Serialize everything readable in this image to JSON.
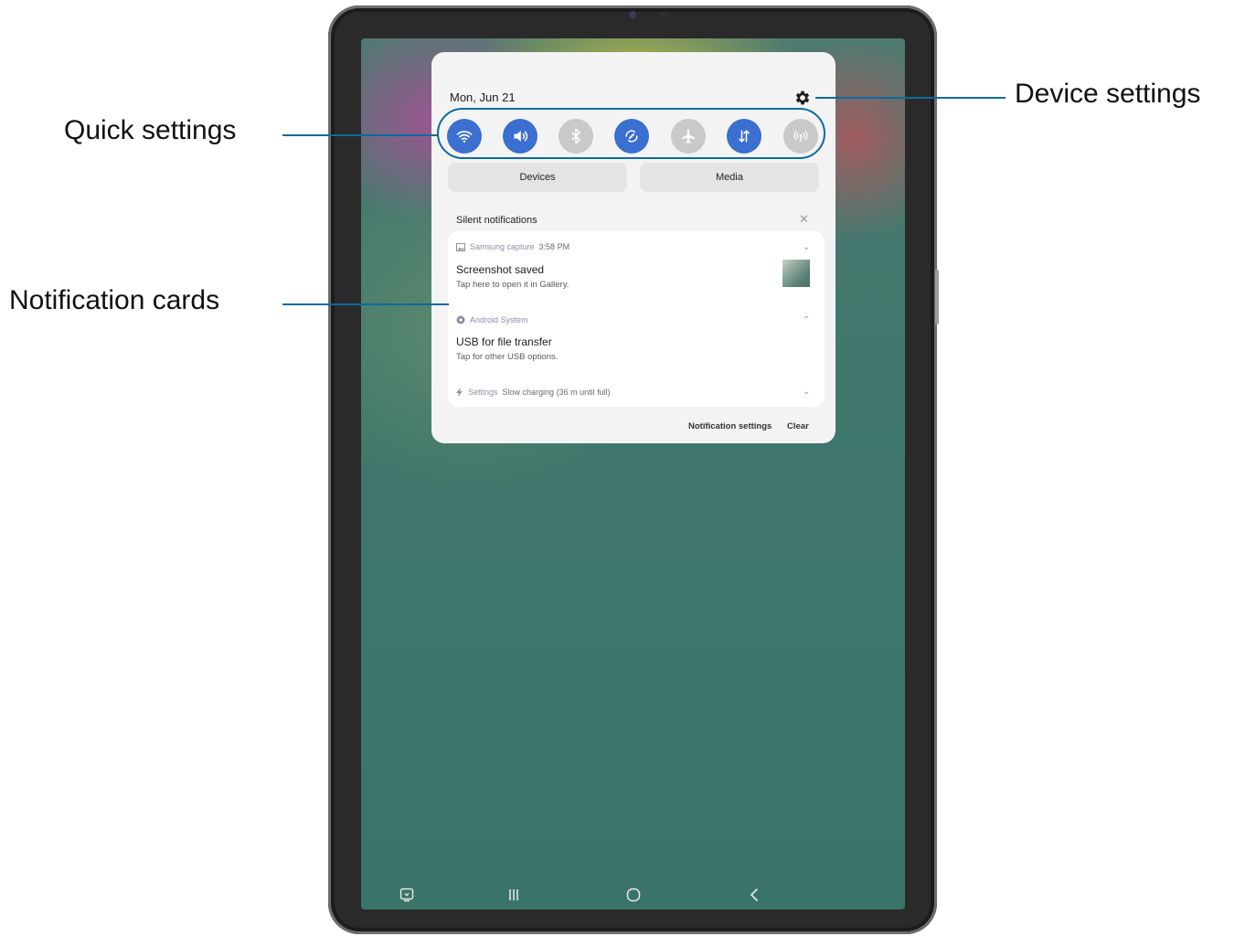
{
  "panel": {
    "date": "Mon, Jun 21",
    "quick_settings": [
      {
        "icon": "wifi-icon",
        "state": "on"
      },
      {
        "icon": "sound-icon",
        "state": "on"
      },
      {
        "icon": "bluetooth-icon",
        "state": "off"
      },
      {
        "icon": "auto-rotate-icon",
        "state": "on"
      },
      {
        "icon": "airplane-mode-icon",
        "state": "off"
      },
      {
        "icon": "mobile-data-icon",
        "state": "on"
      },
      {
        "icon": "hotspot-icon",
        "state": "off"
      }
    ],
    "devices_label": "Devices",
    "media_label": "Media",
    "silent_notifications_label": "Silent notifications",
    "notifications": [
      {
        "app": "Samsung capture",
        "time": "3:58 PM",
        "title": "Screenshot saved",
        "text": "Tap here to open it in Gallery."
      },
      {
        "app": "Android System",
        "title": "USB for file transfer",
        "text": "Tap for other USB options."
      },
      {
        "app": "Settings",
        "text": "Slow charging (36 m until full)"
      }
    ],
    "notification_settings_label": "Notification settings",
    "clear_label": "Clear"
  },
  "callouts": {
    "quick_settings": "Quick settings",
    "notification_cards": "Notification cards",
    "device_settings": "Device settings"
  },
  "colors": {
    "accent": "#3b6fd0",
    "callout_line": "#0b6aa2"
  }
}
